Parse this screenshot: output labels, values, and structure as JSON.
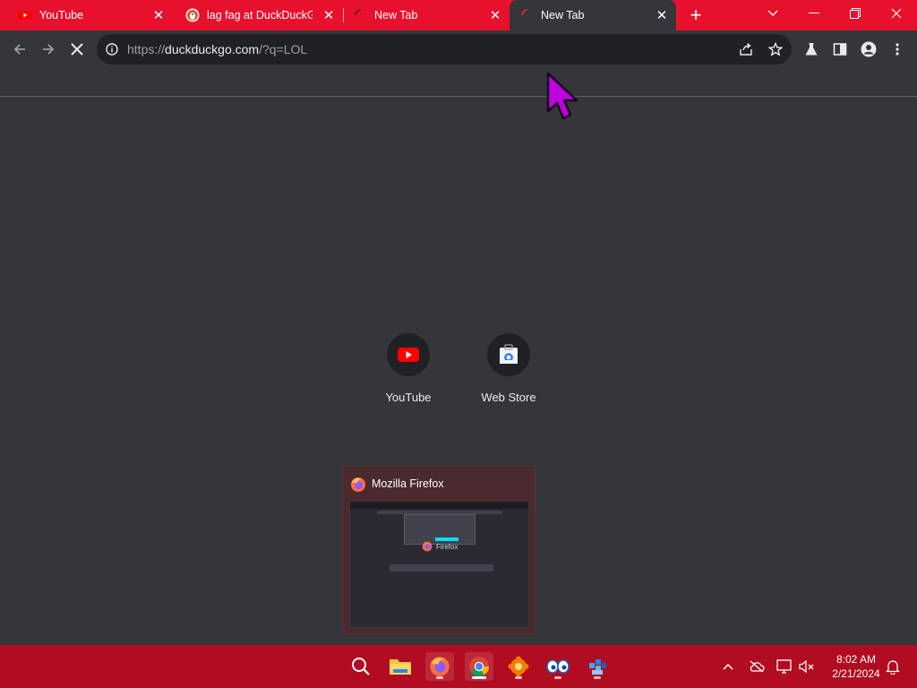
{
  "tabs": [
    {
      "title": "YouTube",
      "favicon": "youtube-icon"
    },
    {
      "title": "lag fag at DuckDuckGo",
      "favicon": "duckduckgo-icon"
    },
    {
      "title": "New Tab",
      "favicon": "loading-spinner-icon"
    },
    {
      "title": "New Tab",
      "favicon": "loading-spinner-icon",
      "active": true
    }
  ],
  "omnibox": {
    "scheme": "https://",
    "host": "duckduckgo.com",
    "path": "/?q=LOL"
  },
  "shortcuts": [
    {
      "label": "YouTube",
      "icon": "youtube-icon"
    },
    {
      "label": "Web Store",
      "icon": "web-store-icon"
    }
  ],
  "taskbar_preview": {
    "title": "Mozilla Firefox",
    "thumbnail_text": "Firefox"
  },
  "clock": {
    "time": "8:02 AM",
    "date": "2/21/2024"
  },
  "colors": {
    "tabstrip": "#e8112d",
    "taskbar": "#b10c1f",
    "page_bg": "#35363a",
    "omnibox_bg": "#202124"
  }
}
